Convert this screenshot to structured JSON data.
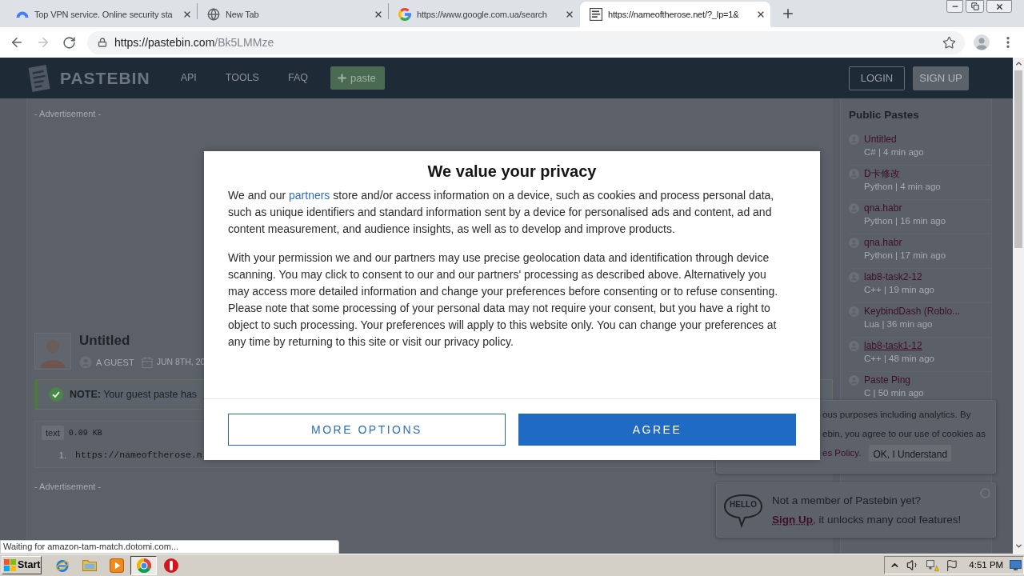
{
  "browser": {
    "tabs": [
      {
        "kind": "arch",
        "title": "Top VPN service. Online security sta",
        "selected": false
      },
      {
        "kind": "globe",
        "title": "New Tab",
        "selected": false
      },
      {
        "kind": "g-mark",
        "title": "https://www.google.com.ua/search",
        "selected": false
      },
      {
        "kind": "document",
        "title": "https://nameoftherose.net/?_lp=1&",
        "selected": true
      }
    ],
    "url_host": "https://pastebin.com",
    "url_path": "/Bk5LMMze"
  },
  "site_header": {
    "logo": "PASTEBIN",
    "nav": [
      "API",
      "TOOLS",
      "FAQ"
    ],
    "new_paste": "paste",
    "login": "LOGIN",
    "signup": "SIGN UP"
  },
  "main": {
    "ad_top": "- Advertisement -",
    "paste": {
      "title": "Untitled",
      "author": "A GUEST",
      "date": "JUN 8TH, 20",
      "note": "**NOTE:** Your guest paste has",
      "syntax": "text",
      "size": "0.09 KB",
      "lines": [
        {
          "number": "1.",
          "code": "https://nameoftherose.n"
        }
      ]
    },
    "ad_bottom": "- Advertisement -"
  },
  "public_pastes": {
    "title": "Public Pastes",
    "items": [
      {
        "title": "Untitled",
        "meta": "C# | 4 min ago",
        "hovered": false
      },
      {
        "title": "D卡修改",
        "meta": "Python | 4 min ago",
        "hovered": false
      },
      {
        "title": "qna.habr",
        "meta": "Python | 16 min ago",
        "hovered": false
      },
      {
        "title": "qna.habr",
        "meta": "Python | 17 min ago",
        "hovered": false
      },
      {
        "title": "lab8-task2-12",
        "meta": "C++ | 19 min ago",
        "hovered": false
      },
      {
        "title": "KeybindDash (Roblo...",
        "meta": "Lua | 36 min ago",
        "hovered": false
      },
      {
        "title": "lab8-task1-12",
        "meta": "C++ | 48 min ago",
        "hovered": true
      },
      {
        "title": "Paste Ping",
        "meta": "C | 50 min ago",
        "hovered": false
      }
    ]
  },
  "consent_dialog": {
    "title": "We value your privacy",
    "intro": {
      "before": "We and our",
      "link": "partners",
      "after": "store and/or access information on a device, such as cookies and process personal data, such as unique identifiers and standard information sent by a device for personalised ads and content, ad and content measurement, and audience insights, as well as to develop and improve products."
    },
    "paragraph": "With your permission we and our partners may use precise geolocation data and identification through device scanning. You may click to consent to our and our partners' processing as described above. Alternatively you may access more detailed information and change your preferences before consenting or to refuse consenting. Please note that some processing of your personal data may not require your consent, but you have a right to object to such processing. Your preferences will apply to this website only. You can change your preferences at any time by returning to this site or visit our privacy policy.",
    "buttons": [
      {
        "kind": "outline",
        "label": "MORE OPTIONS"
      },
      {
        "kind": "primary",
        "label": "AGREE"
      }
    ]
  },
  "cookie_notice": {
    "lines": [
      "ous purposes including analytics. By",
      "ebin, you agree to our use of cookies as"
    ],
    "policy_link": "es Policy",
    "policy_tail": ".",
    "button": "OK, I Understand"
  },
  "signup_prompt": {
    "badge": "HELLO",
    "question": "Not a member of Pastebin yet?",
    "link": "Sign Up",
    "rest": ", it unlocks many cool features!"
  },
  "status_bubble": "Waiting for amazon-tam-match.dotomi.com...",
  "taskbar": {
    "start": "Start",
    "apps": [
      {
        "kind": "orbit",
        "selected": false
      },
      {
        "kind": "folder",
        "selected": false
      },
      {
        "kind": "player",
        "selected": false
      },
      {
        "kind": "round",
        "selected": true
      },
      {
        "kind": "ring",
        "selected": false
      }
    ],
    "clock": "4:51 PM"
  }
}
